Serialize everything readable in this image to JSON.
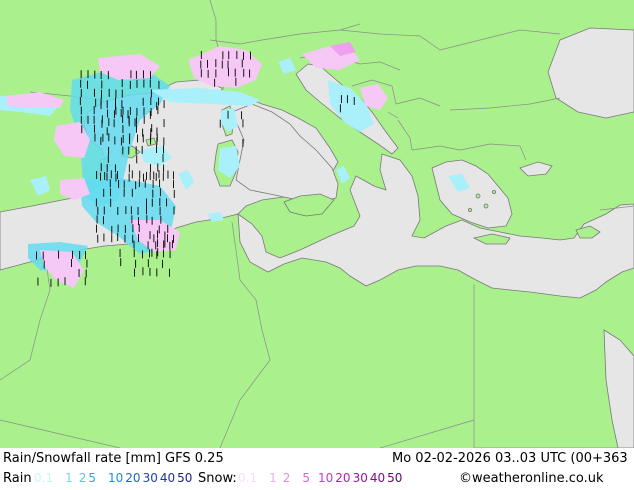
{
  "footer": {
    "title": "Rain/Snowfall rate [mm] GFS 0.25",
    "datetime": "Mo 02-02-2026 03..03 UTC (00+363",
    "rain_label": "Rain",
    "snow_label": "Snow:",
    "credit": "©weatheronline.co.uk"
  },
  "legend": {
    "rain": [
      {
        "label": "0.1",
        "color": "#c8f5fa"
      },
      {
        "label": "1",
        "color": "#78d8f0"
      },
      {
        "label": "2",
        "color": "#50c8f0"
      },
      {
        "label": "5",
        "color": "#28a8e8"
      },
      {
        "label": "10",
        "color": "#1e8ce0"
      },
      {
        "label": "20",
        "color": "#1e64c8"
      },
      {
        "label": "30",
        "color": "#1e46b4"
      },
      {
        "label": "40",
        "color": "#1e32a0"
      },
      {
        "label": "50",
        "color": "#1e1e8c"
      }
    ],
    "snow": [
      {
        "label": "0.1",
        "color": "#fadcfa"
      },
      {
        "label": "1",
        "color": "#f0aaf0"
      },
      {
        "label": "2",
        "color": "#e68ce6"
      },
      {
        "label": "5",
        "color": "#dc64dc"
      },
      {
        "label": "10",
        "color": "#c83cc8"
      },
      {
        "label": "20",
        "color": "#b41eb4"
      },
      {
        "label": "30",
        "color": "#9614a0"
      },
      {
        "label": "40",
        "color": "#820a8c"
      },
      {
        "label": "50",
        "color": "#6e0078"
      }
    ]
  },
  "map": {
    "colors": {
      "land": "#aaf08c",
      "sea": "#e6e6e6",
      "border": "#8c8c8c",
      "coast": "#787878",
      "rain_light": "#aaf0fa",
      "rain_mod": "#64dcf0",
      "snow_light": "#f5c8f5",
      "snow_mod": "#f0a0f0",
      "label_text": "#000000"
    }
  }
}
